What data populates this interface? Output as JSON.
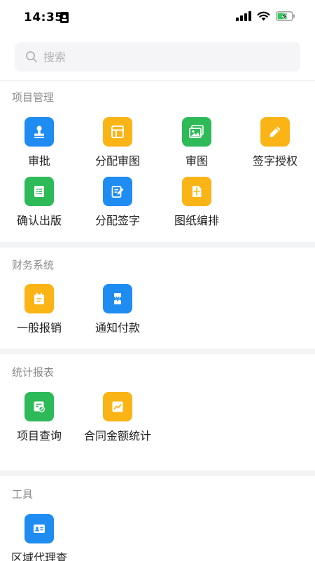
{
  "status_bar": {
    "time": "14:35"
  },
  "search": {
    "placeholder": "搜索"
  },
  "sections": [
    {
      "title": "项目管理",
      "items": [
        {
          "label": "审批",
          "icon": "stamp-icon",
          "color": "#1f8cf2"
        },
        {
          "label": "分配审图",
          "icon": "layout-icon",
          "color": "#fbb416"
        },
        {
          "label": "审图",
          "icon": "image-gallery-icon",
          "color": "#2eba58"
        },
        {
          "label": "签字授权",
          "icon": "pencil-icon",
          "color": "#fbb416"
        },
        {
          "label": "确认出版",
          "icon": "document-list-icon",
          "color": "#2eba58"
        },
        {
          "label": "分配签字",
          "icon": "edit-document-icon",
          "color": "#1f8cf2"
        },
        {
          "label": "图纸编排",
          "icon": "blueprint-icon",
          "color": "#fbb416"
        }
      ]
    },
    {
      "title": "财务系统",
      "items": [
        {
          "label": "一般报销",
          "icon": "calendar-icon",
          "color": "#fbb416"
        },
        {
          "label": "通知付款",
          "icon": "yuan-ticket-icon",
          "color": "#1f8cf2"
        }
      ]
    },
    {
      "title": "统计报表",
      "items": [
        {
          "label": "项目查询",
          "icon": "search-document-icon",
          "color": "#2eba58"
        },
        {
          "label": "合同金额统计",
          "icon": "trend-chart-icon",
          "color": "#fbb416"
        }
      ]
    },
    {
      "title": "工具",
      "items": [
        {
          "label": "区域代理查",
          "icon": "contact-card-icon",
          "color": "#1f8cf2"
        }
      ]
    }
  ]
}
